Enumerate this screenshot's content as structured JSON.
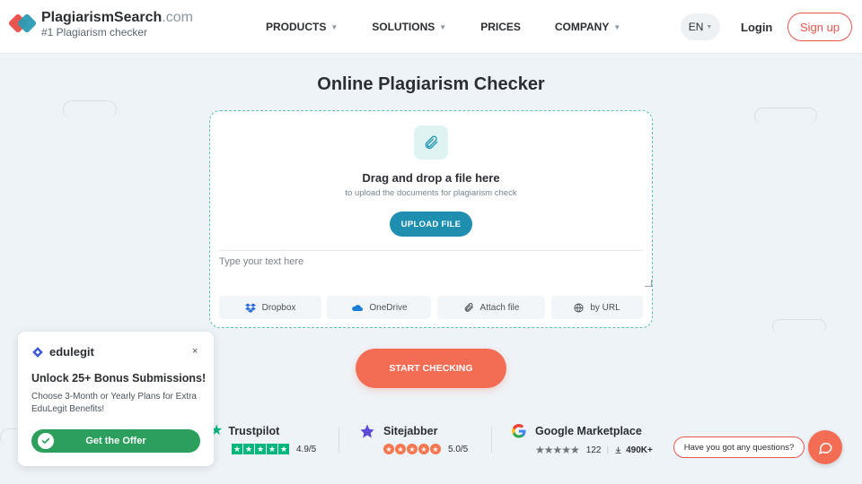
{
  "header": {
    "logo_name": "PlagiarismSearch",
    "logo_domain": ".com",
    "logo_tagline": "#1 Plagiarism checker",
    "nav": [
      {
        "label": "PRODUCTS",
        "has_caret": true
      },
      {
        "label": "SOLUTIONS",
        "has_caret": true
      },
      {
        "label": "PRICES",
        "has_caret": false
      },
      {
        "label": "COMPANY",
        "has_caret": true
      }
    ],
    "lang": "EN",
    "login": "Login",
    "signup": "Sign up"
  },
  "main": {
    "title": "Online Plagiarism Checker",
    "drop_title": "Drag and drop a file here",
    "drop_sub": "to upload the documents for plagiarism check",
    "upload_label": "UPLOAD FILE",
    "text_placeholder": "Type your text here",
    "sources": [
      {
        "label": "Dropbox",
        "icon": "dropbox-icon"
      },
      {
        "label": "OneDrive",
        "icon": "onedrive-icon"
      },
      {
        "label": "Attach file",
        "icon": "paperclip-icon"
      },
      {
        "label": "by URL",
        "icon": "globe-icon"
      }
    ],
    "start_label": "START CHECKING"
  },
  "ratings": [
    {
      "name": "Trustpilot",
      "score": "4.9/5"
    },
    {
      "name": "Sitejabber",
      "score": "5.0/5"
    },
    {
      "name": "Google Marketplace",
      "reviews": "122",
      "installs": "490K+"
    }
  ],
  "popup": {
    "brand": "edulegit",
    "close": "×",
    "title": "Unlock 25+ Bonus Submissions!",
    "text": "Choose 3-Month or Yearly Plans for Extra EduLegit Benefits!",
    "cta": "Get the Offer"
  },
  "chat": {
    "question": "Have you got any questions?"
  },
  "colors": {
    "brand_red": "#e8554e",
    "brand_teal": "#2a9bb4",
    "upload_blue": "#1f8fb0",
    "start_coral": "#f36d55",
    "offer_green": "#2c9f5c",
    "trustpilot_green": "#00b67a"
  }
}
